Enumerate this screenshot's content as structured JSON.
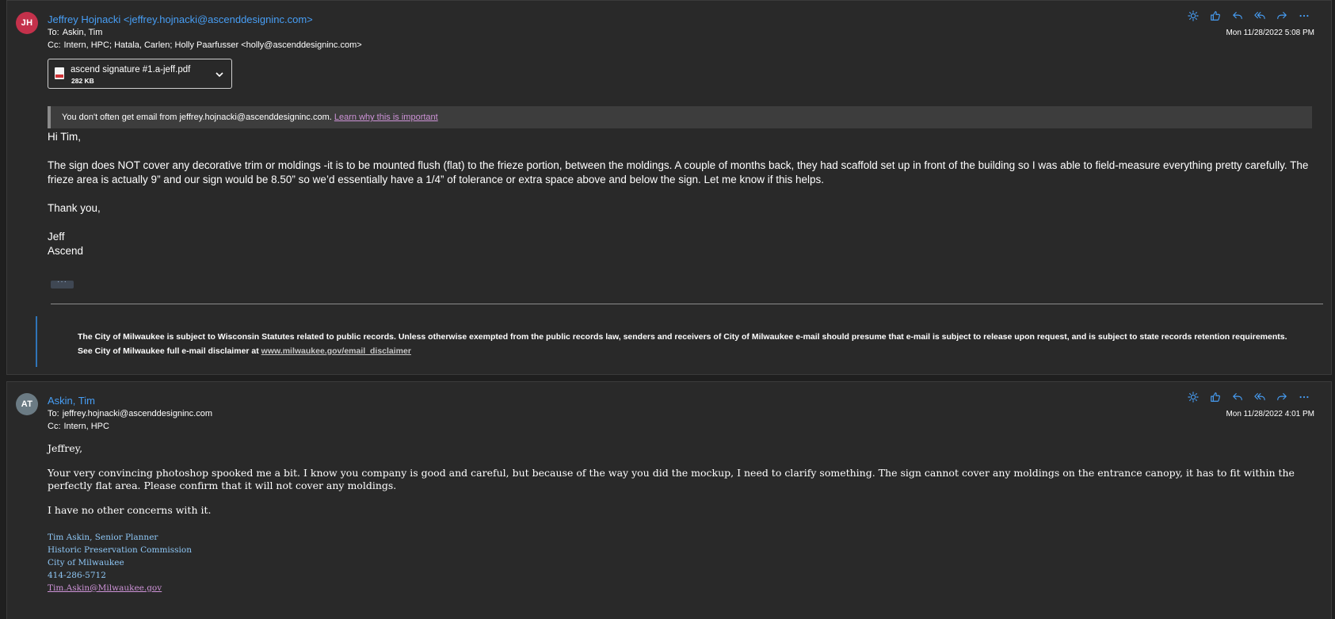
{
  "colors": {
    "accent": "#479ef5",
    "avatar_jh": "#c4314b",
    "avatar_at": "#6b7b84",
    "link": "#ce93d8",
    "signature": "#8ec7f6"
  },
  "actions": [
    {
      "icon": "sun-icon"
    },
    {
      "icon": "like-icon"
    },
    {
      "icon": "reply-icon"
    },
    {
      "icon": "reply-all-icon"
    },
    {
      "icon": "forward-icon"
    },
    {
      "icon": "more-icon"
    }
  ],
  "message1": {
    "avatar_initials": "JH",
    "sender": "Jeffrey Hojnacki <jeffrey.hojnacki@ascenddesigninc.com>",
    "to_label": "To:",
    "to": "Askin, Tim",
    "cc_label": "Cc:",
    "cc": "Intern, HPC;  Hatala, Carlen;  Holly Paarfusser <holly@ascenddesigninc.com>",
    "date": "Mon 11/28/2022 5:08 PM",
    "attachment": {
      "name": "ascend signature #1.a-jeff.pdf",
      "size": "282 KB",
      "icon": "pdf-file-icon"
    },
    "banner": {
      "text": "You don't often get email from jeffrey.hojnacki@ascenddesigninc.com. ",
      "link": "Learn why this is important"
    },
    "body": {
      "greeting": "Hi Tim,",
      "para": "The sign does NOT cover any decorative trim or moldings -it is to be mounted flush (flat) to the frieze portion, between the moldings. A couple of months back, they had scaffold set up in front of the building so I was able to field-measure everything pretty carefully. The frieze area is actually 9” and our sign would be 8.50” so we’d essentially have a 1/4” of tolerance or extra space above and below the sign. Let me know if this helps.",
      "thanks": "Thank you,",
      "name": "Jeff",
      "company": "Ascend"
    },
    "expand_label": "···",
    "disclaimer": {
      "text": "The City of Milwaukee is subject to Wisconsin Statutes related to public records. Unless otherwise exempted from the public records law, senders and receivers of City of Milwaukee e-mail should presume that e-mail is subject to release upon request, and is subject to state records retention requirements. See City of Milwaukee full e-mail disclaimer at ",
      "link": "www.milwaukee.gov/email_disclaimer"
    }
  },
  "message2": {
    "avatar_initials": "AT",
    "sender": "Askin, Tim",
    "to_label": "To:",
    "to": "jeffrey.hojnacki@ascenddesigninc.com",
    "cc_label": "Cc:",
    "cc": "Intern, HPC",
    "date": "Mon 11/28/2022 4:01 PM",
    "body": {
      "greeting": "Jeffrey,",
      "para": "Your very convincing photoshop spooked me a bit. I know you company is good and careful, but because of the way you did the mockup, I need to clarify something. The sign cannot cover any moldings on the entrance canopy, it has to fit within the perfectly flat area. Please confirm that it will not cover any moldings.",
      "concerns": "I have no other concerns with it."
    },
    "signature": {
      "name_title": "Tim Askin, Senior Planner",
      "dept": "Historic Preservation Commission",
      "org": "City of Milwaukee",
      "phone": "414-286-5712",
      "email": "Tim.Askin@Milwaukee.gov"
    }
  }
}
